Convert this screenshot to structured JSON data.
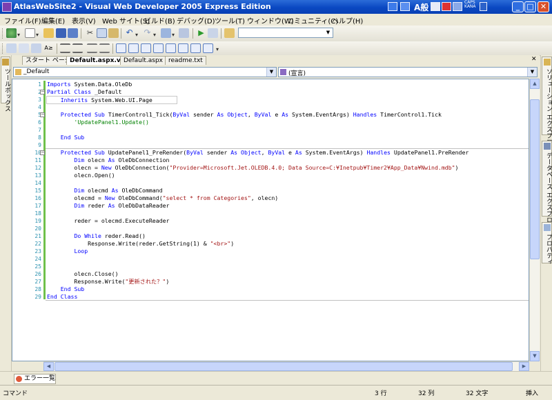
{
  "window": {
    "title": "AtlasWebSite2 - Visual Web Developer 2005 Express Edition",
    "ime_text": "A般",
    "caps_label": "CAPS",
    "kana_label": "KANA"
  },
  "menu": [
    "ファイル(F)",
    "編集(E)",
    "表示(V)",
    "Web サイト(S)",
    "ビルド(B)",
    "デバッグ(D)",
    "ツール(T)",
    "ウィンドウ(W)",
    "コミュニティ(C)",
    "ヘルプ(H)"
  ],
  "left_dock": {
    "toolbox_label": "ツールボックス"
  },
  "right_dock": [
    {
      "label": "ソリューション エクスプローラ"
    },
    {
      "label": "データベース エクスプローラ"
    },
    {
      "label": "プロパティ"
    }
  ],
  "tabs": [
    {
      "label": "スタート ページ",
      "active": false
    },
    {
      "label": "Default.aspx.vb",
      "active": true
    },
    {
      "label": "Default.aspx",
      "active": false
    },
    {
      "label": "readme.txt",
      "active": false
    }
  ],
  "tab_close": "✕",
  "nav": {
    "class_combo": "_Default",
    "member_combo": "(宣言)"
  },
  "code": {
    "lines": [
      {
        "n": "1",
        "text": "Imports System.Data.OleDb"
      },
      {
        "n": "2",
        "text": "Partial Class _Default"
      },
      {
        "n": "3",
        "text": "    Inherits System.Web.UI.Page"
      },
      {
        "n": "4",
        "text": ""
      },
      {
        "n": "5",
        "text": "    Protected Sub TimerControl1_Tick(ByVal sender As Object, ByVal e As System.EventArgs) Handles TimerControl1.Tick"
      },
      {
        "n": "6",
        "text": "        'UpdatePanel1.Update()"
      },
      {
        "n": "7",
        "text": ""
      },
      {
        "n": "8",
        "text": "    End Sub"
      },
      {
        "n": "9",
        "text": ""
      },
      {
        "n": "10",
        "text": "    Protected Sub UpdatePanel1_PreRender(ByVal sender As Object, ByVal e As System.EventArgs) Handles UpdatePanel1.PreRender"
      },
      {
        "n": "11",
        "text": "        Dim olecn As OleDbConnection"
      },
      {
        "n": "12",
        "text": "        olecn = New OleDbConnection(\"Provider=Microsoft.Jet.OLEDB.4.0; Data Source=C:¥Inetpub¥Timer2¥App_Data¥Nwind.mdb\")"
      },
      {
        "n": "13",
        "text": "        olecn.Open()"
      },
      {
        "n": "14",
        "text": ""
      },
      {
        "n": "15",
        "text": "        Dim olecmd As OleDbCommand"
      },
      {
        "n": "16",
        "text": "        olecmd = New OleDbCommand(\"select * from Categories\", olecn)"
      },
      {
        "n": "17",
        "text": "        Dim reder As OleDbDataReader"
      },
      {
        "n": "18",
        "text": ""
      },
      {
        "n": "19",
        "text": "        reder = olecmd.ExecuteReader"
      },
      {
        "n": "20",
        "text": ""
      },
      {
        "n": "21",
        "text": "        Do While reder.Read()"
      },
      {
        "n": "22",
        "text": "            Response.Write(reder.GetString(1) & \"<br>\")"
      },
      {
        "n": "23",
        "text": "        Loop"
      },
      {
        "n": "24",
        "text": ""
      },
      {
        "n": "25",
        "text": ""
      },
      {
        "n": "26",
        "text": "        olecn.Close()"
      },
      {
        "n": "27",
        "text": "        Response.Write(\"更新された？\")"
      },
      {
        "n": "28",
        "text": "    End Sub"
      },
      {
        "n": "29",
        "text": "End Class"
      }
    ]
  },
  "error_tab": {
    "label": "エラー一覧"
  },
  "status": {
    "mode": "コマンド",
    "line": "3 行",
    "col": "32 列",
    "ch": "32 文字",
    "ins": "挿入"
  },
  "colors": {
    "keyword": "#0000ff",
    "string": "#a31515",
    "comment": "#008000",
    "line_number": "#2b91af",
    "change_bar": "#6fc04a"
  }
}
